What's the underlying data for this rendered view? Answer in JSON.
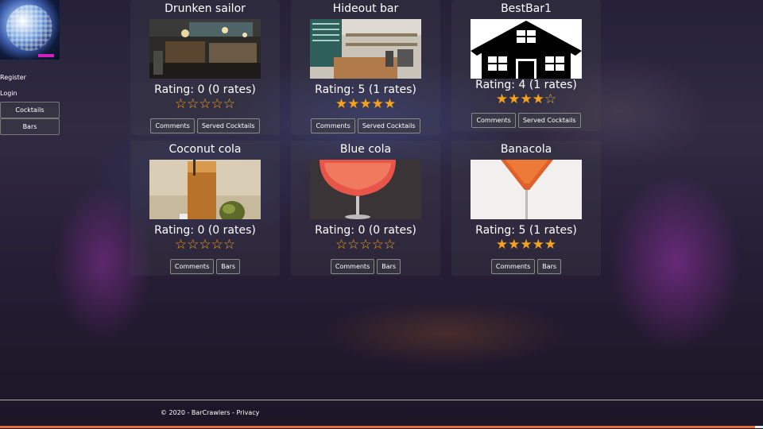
{
  "sidebar": {
    "register_label": "Register",
    "login_label": "Login",
    "cocktails_label": "Cocktails",
    "bars_label": "Bars"
  },
  "cards": [
    {
      "title": "Drunken sailor",
      "rating": "Rating: 0 (0 rates)",
      "stars": "☆☆☆☆☆",
      "stars_value": 0,
      "btn1": "Comments",
      "btn2": "Served Cocktails"
    },
    {
      "title": "Hideout bar",
      "rating": "Rating: 5 (1 rates)",
      "stars": "★★★★★",
      "stars_value": 5,
      "btn1": "Comments",
      "btn2": "Served Cocktails"
    },
    {
      "title": "BestBar1",
      "rating": "Rating: 4 (1 rates)",
      "stars": "★★★★☆",
      "stars_value": 4,
      "btn1": "Comments",
      "btn2": "Served Cocktails"
    },
    {
      "title": "Coconut cola",
      "rating": "Rating: 0 (0 rates)",
      "stars": "☆☆☆☆☆",
      "stars_value": 0,
      "btn1": "Comments",
      "btn2": "Bars"
    },
    {
      "title": "Blue cola",
      "rating": "Rating: 0 (0 rates)",
      "stars": "☆☆☆☆☆",
      "stars_value": 0,
      "btn1": "Comments",
      "btn2": "Bars"
    },
    {
      "title": "Banacola",
      "rating": "Rating: 5 (1 rates)",
      "stars": "★★★★★",
      "stars_value": 5,
      "btn1": "Comments",
      "btn2": "Bars"
    }
  ],
  "footer": {
    "text": "© 2020 - BarCrawlers - Privacy"
  },
  "colors": {
    "star": "#f7a21b",
    "accent_bar": "#e0703a"
  }
}
